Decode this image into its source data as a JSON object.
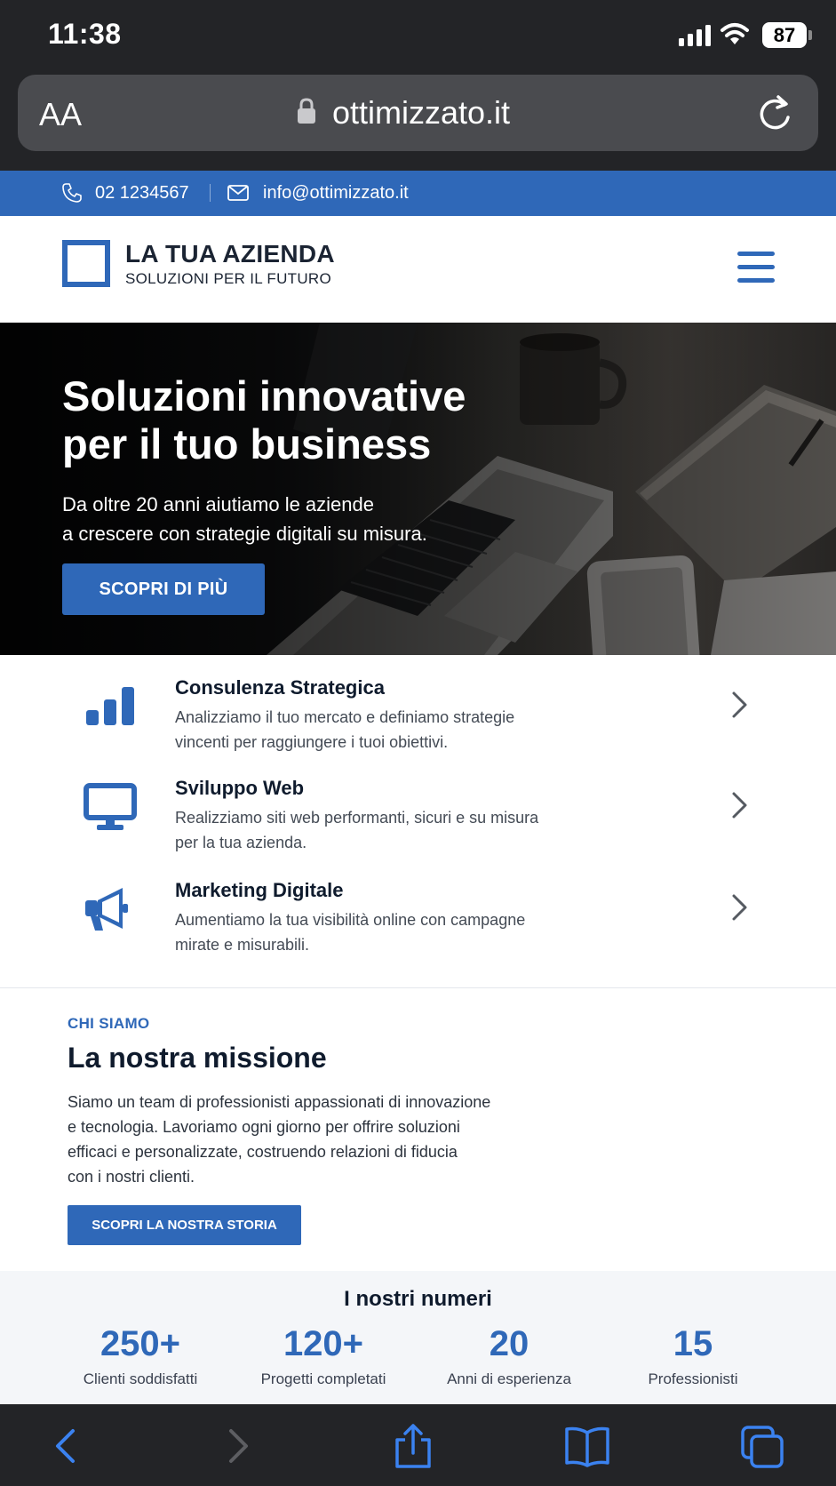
{
  "status_bar": {
    "time": "11:38",
    "battery": "87"
  },
  "browser": {
    "text_size_label": "AA",
    "domain": "ottimizzato.it"
  },
  "contact_bar": {
    "phone": "02 1234567",
    "email": "info@ottimizzato.it"
  },
  "header": {
    "brand_name": "LA TUA AZIENDA",
    "brand_tagline": "SOLUZIONI PER IL FUTURO"
  },
  "hero": {
    "title_line1": "Soluzioni innovative",
    "title_line2": "per il tuo business",
    "subtitle_line1": "Da oltre 20 anni aiutiamo le aziende",
    "subtitle_line2": "a crescere con strategie digitali su misura.",
    "cta": "SCOPRI DI PIÙ"
  },
  "services": [
    {
      "icon": "bar-chart-icon",
      "title": "Consulenza Strategica",
      "desc_line1": "Analizziamo il tuo mercato e definiamo strategie",
      "desc_line2": "vincenti per raggiungere i tuoi obiettivi."
    },
    {
      "icon": "monitor-icon",
      "title": "Sviluppo Web",
      "desc_line1": "Realizziamo siti web performanti, sicuri e su misura",
      "desc_line2": "per la tua azienda."
    },
    {
      "icon": "megaphone-icon",
      "title": "Marketing Digitale",
      "desc_line1": "Aumentiamo la tua visibilità online con campagne",
      "desc_line2": "mirate e misurabili."
    }
  ],
  "about": {
    "eyebrow": "CHI SIAMO",
    "title": "La nostra missione",
    "text_line1": "Siamo un team di professionisti appassionati di innovazione",
    "text_line2": "e tecnologia. Lavoriamo ogni giorno per offrire soluzioni",
    "text_line3": "efficaci e personalizzate, costruendo relazioni di fiducia",
    "text_line4": "con i nostri clienti.",
    "cta": "SCOPRI LA NOSTRA STORIA"
  },
  "stats": {
    "title": "I nostri numeri",
    "items": [
      {
        "value": "250+",
        "label": "Clienti soddisfatti"
      },
      {
        "value": "120+",
        "label": "Progetti completati"
      },
      {
        "value": "20",
        "label": "Anni di esperienza"
      },
      {
        "value": "15",
        "label": "Professionisti"
      }
    ]
  },
  "colors": {
    "accent": "#2f68b8",
    "dark": "#0f1b2d",
    "chrome": "#232427"
  }
}
